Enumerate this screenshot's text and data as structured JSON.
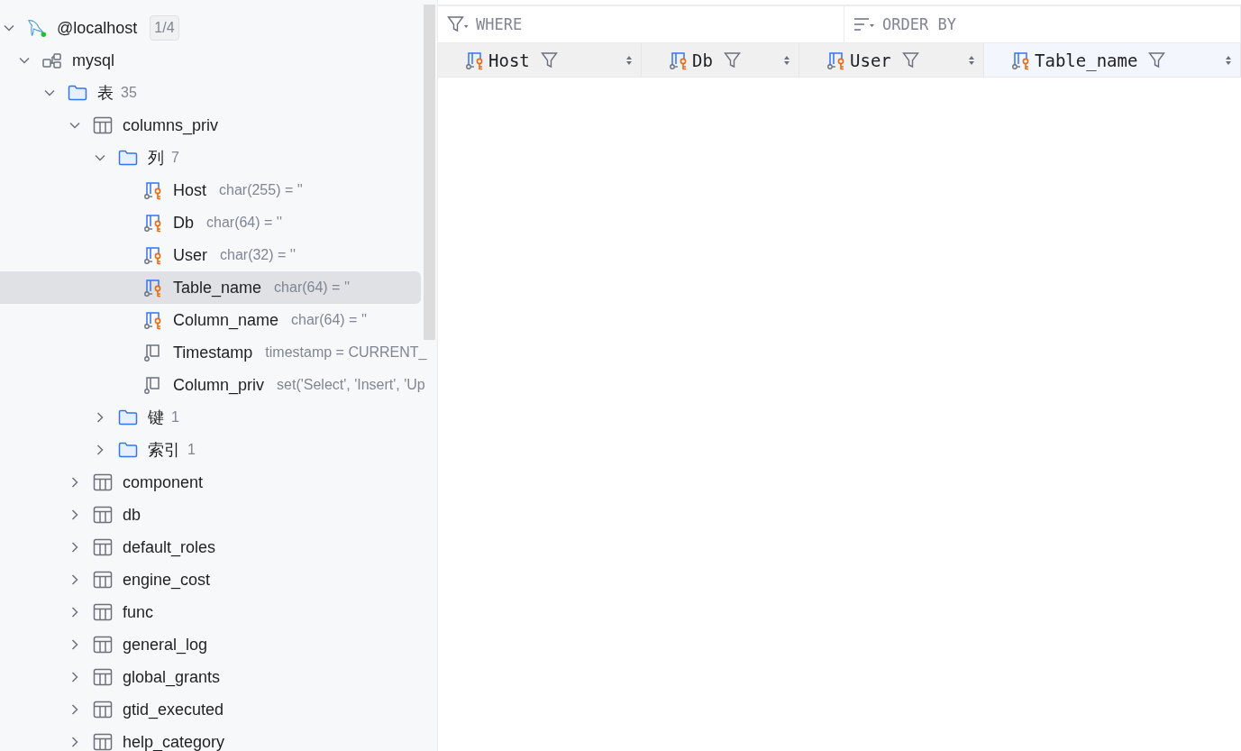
{
  "tree": [
    {
      "kind": "connection",
      "label": "@localhost",
      "badge": "1/4",
      "expanded": true,
      "selected": false,
      "children": [
        {
          "kind": "schema",
          "label": "mysql",
          "expanded": true,
          "selected": false,
          "children": [
            {
              "kind": "folder",
              "label": "表",
              "count": "35",
              "expanded": true,
              "selected": false,
              "children": [
                {
                  "kind": "table",
                  "label": "columns_priv",
                  "expanded": true,
                  "selected": false,
                  "children": [
                    {
                      "kind": "folder",
                      "label": "列",
                      "count": "7",
                      "expanded": true,
                      "selected": false,
                      "children": [
                        {
                          "kind": "key-column",
                          "label": "Host",
                          "detail": "char(255) = ''",
                          "selected": false
                        },
                        {
                          "kind": "key-column",
                          "label": "Db",
                          "detail": "char(64) = ''",
                          "selected": false
                        },
                        {
                          "kind": "key-column",
                          "label": "User",
                          "detail": "char(32) = ''",
                          "selected": false
                        },
                        {
                          "kind": "key-column",
                          "label": "Table_name",
                          "detail": "char(64) = ''",
                          "selected": true
                        },
                        {
                          "kind": "key-column",
                          "label": "Column_name",
                          "detail": "char(64) = ''",
                          "selected": false
                        },
                        {
                          "kind": "column",
                          "label": "Timestamp",
                          "detail": "timestamp = CURRENT_",
                          "selected": false
                        },
                        {
                          "kind": "column",
                          "label": "Column_priv",
                          "detail": "set('Select', 'Insert', 'Up",
                          "selected": false
                        }
                      ]
                    },
                    {
                      "kind": "folder",
                      "label": "键",
                      "count": "1",
                      "expanded": false,
                      "selected": false
                    },
                    {
                      "kind": "folder",
                      "label": "索引",
                      "count": "1",
                      "expanded": false,
                      "selected": false
                    }
                  ]
                },
                {
                  "kind": "table",
                  "label": "component",
                  "expanded": false,
                  "selected": false
                },
                {
                  "kind": "table",
                  "label": "db",
                  "expanded": false,
                  "selected": false
                },
                {
                  "kind": "table",
                  "label": "default_roles",
                  "expanded": false,
                  "selected": false
                },
                {
                  "kind": "table",
                  "label": "engine_cost",
                  "expanded": false,
                  "selected": false
                },
                {
                  "kind": "table",
                  "label": "func",
                  "expanded": false,
                  "selected": false
                },
                {
                  "kind": "table",
                  "label": "general_log",
                  "expanded": false,
                  "selected": false
                },
                {
                  "kind": "table",
                  "label": "global_grants",
                  "expanded": false,
                  "selected": false
                },
                {
                  "kind": "table",
                  "label": "gtid_executed",
                  "expanded": false,
                  "selected": false
                },
                {
                  "kind": "table",
                  "label": "help_category",
                  "expanded": false,
                  "selected": false
                }
              ]
            }
          ]
        }
      ]
    }
  ],
  "filter_bar": {
    "where": "WHERE",
    "order_by": "ORDER BY"
  },
  "grid": {
    "columns": [
      {
        "name": "Host",
        "selected": false
      },
      {
        "name": "Db",
        "selected": false
      },
      {
        "name": "User",
        "selected": false
      },
      {
        "name": "Table_name",
        "selected": true
      }
    ]
  }
}
